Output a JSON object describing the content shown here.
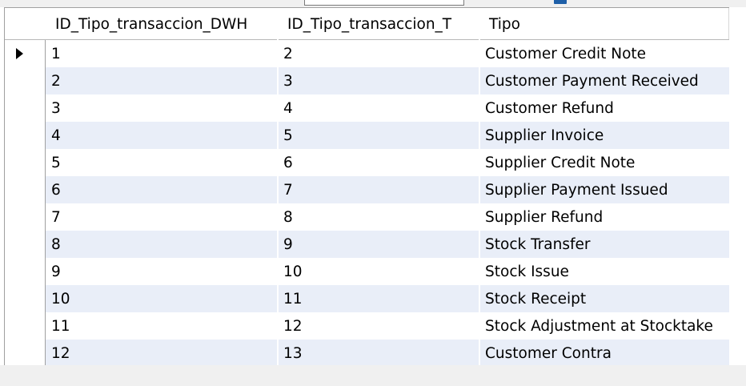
{
  "grid": {
    "columns": [
      "ID_Tipo_transaccion_DWH",
      "ID_Tipo_transaccion_T",
      "Tipo"
    ],
    "rows": [
      [
        "1",
        "2",
        "Customer Credit Note"
      ],
      [
        "2",
        "3",
        "Customer Payment Received"
      ],
      [
        "3",
        "4",
        "Customer Refund"
      ],
      [
        "4",
        "5",
        "Supplier Invoice"
      ],
      [
        "5",
        "6",
        "Supplier Credit Note"
      ],
      [
        "6",
        "7",
        "Supplier Payment Issued"
      ],
      [
        "7",
        "8",
        "Supplier Refund"
      ],
      [
        "8",
        "9",
        "Stock Transfer"
      ],
      [
        "9",
        "10",
        "Stock Issue"
      ],
      [
        "10",
        "11",
        "Stock Receipt"
      ],
      [
        "11",
        "12",
        "Stock Adjustment at Stocktake"
      ],
      [
        "12",
        "13",
        "Customer Contra"
      ]
    ],
    "current_row_index": 0,
    "alt_row_color": "#e9eef8",
    "current_row_icon": "current-row-arrow-icon"
  }
}
